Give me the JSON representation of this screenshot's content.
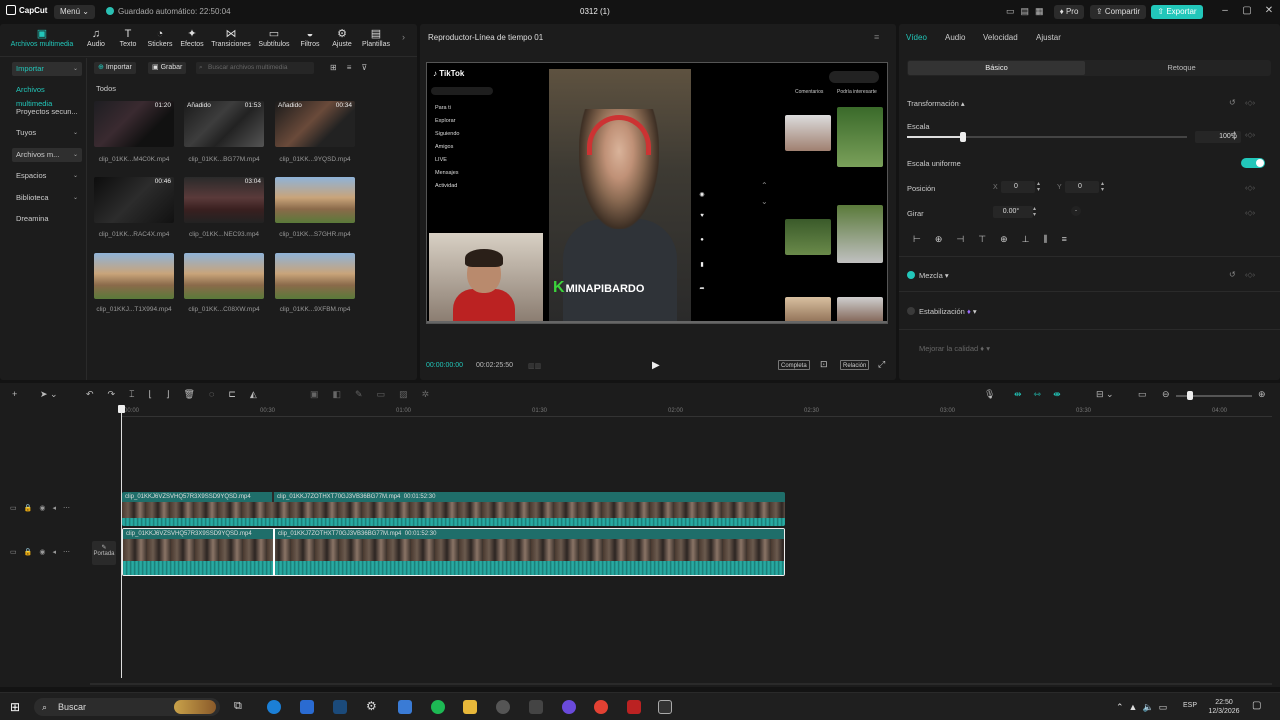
{
  "titlebar": {
    "app_name": "CapCut",
    "menu_label": "Menú",
    "autosave": "Guardado automático: 22:50:04",
    "project_title": "0312 (1)",
    "pro_label": "Pro",
    "share_label": "Compartir",
    "export_label": "Exportar"
  },
  "toolbar": {
    "items": [
      {
        "label": "Archivos multimedia",
        "icon": "media-icon"
      },
      {
        "label": "Audio",
        "icon": "audio-icon"
      },
      {
        "label": "Texto",
        "icon": "text-icon"
      },
      {
        "label": "Stickers",
        "icon": "sticker-icon"
      },
      {
        "label": "Efectos",
        "icon": "effects-icon"
      },
      {
        "label": "Transiciones",
        "icon": "transitions-icon"
      },
      {
        "label": "Subtítulos",
        "icon": "subtitles-icon"
      },
      {
        "label": "Filtros",
        "icon": "filters-icon"
      },
      {
        "label": "Ajuste",
        "icon": "adjust-icon"
      },
      {
        "label": "Plantillas",
        "icon": "templates-icon"
      }
    ]
  },
  "sidebar": {
    "items": [
      {
        "label": "Importar"
      },
      {
        "label": "Archivos multimedia"
      },
      {
        "label": "Proyectos secun..."
      },
      {
        "label": "Tuyos"
      },
      {
        "label": "Archivos m..."
      },
      {
        "label": "Espacios"
      },
      {
        "label": "Biblioteca"
      },
      {
        "label": "Dreamina"
      }
    ]
  },
  "media": {
    "import_label": "Importar",
    "record_label": "Grabar",
    "search_placeholder": "Buscar archivos multimedia",
    "filter_label": "Todos",
    "clips": [
      {
        "name": "clip_01KK...M4C0K.mp4",
        "duration": "01:20",
        "added": ""
      },
      {
        "name": "clip_01KK...BG77M.mp4",
        "duration": "01:53",
        "added": "Añadido"
      },
      {
        "name": "clip_01KK...9YQSD.mp4",
        "duration": "00:34",
        "added": "Añadido"
      },
      {
        "name": "clip_01KK...RAC4X.mp4",
        "duration": "00:46",
        "added": ""
      },
      {
        "name": "clip_01KK...NEC93.mp4",
        "duration": "03:04",
        "added": ""
      },
      {
        "name": "clip_01KK...S7GHR.mp4",
        "duration": "",
        "added": ""
      },
      {
        "name": "clip_01KKJ...T1X994.mp4",
        "duration": "",
        "added": ""
      },
      {
        "name": "clip_01KK...C08XW.mp4",
        "duration": "",
        "added": ""
      },
      {
        "name": "clip_01KK...9XFBM.mp4",
        "duration": "",
        "added": ""
      }
    ]
  },
  "player": {
    "title": "Reproductor-Línea de tiempo 01",
    "current_time": "00:00:00:00",
    "total_time": "00:02:25:50",
    "btn_complete": "Completa",
    "btn_ratio": "Relación",
    "tiktok": {
      "logo": "TikTok",
      "nav": [
        "Para ti",
        "Explorar",
        "Siguiendo",
        "Amigos",
        "LIVE",
        "Mensajes",
        "Actividad"
      ],
      "banner": "MINAPIBARDO",
      "banner_k": "K",
      "right_tabs": [
        "Comentarios",
        "Podría interesarte"
      ]
    }
  },
  "props": {
    "tabs": [
      "Vídeo",
      "Audio",
      "Velocidad",
      "Ajustar"
    ],
    "seg_basic": "Básico",
    "seg_retouch": "Retoque",
    "transform": "Transformación",
    "scale_label": "Escala",
    "scale_value": "100%",
    "scale_fraction": 0.2,
    "uniform_label": "Escala uniforme",
    "position_label": "Posición",
    "pos_x_label": "X",
    "pos_x": "0",
    "pos_y_label": "Y",
    "pos_y": "0",
    "rotate_label": "Girar",
    "rotate_value": "0.00°",
    "blend_label": "Mezcla",
    "stabilize_label": "Estabilización",
    "quality_label": "Mejorar la calidad"
  },
  "timeline": {
    "ruler": [
      "00:00",
      "00:30",
      "01:00",
      "01:30",
      "02:00",
      "02:30",
      "03:00",
      "03:30",
      "04:00"
    ],
    "track1": {
      "clip_a": "clip_01KKJ6VZSVHQ57R3X9SSD9YQSD.mp4",
      "clip_b": "clip_01KKJ7ZOTHXT70GJ3VB36BG77M.mp4",
      "clip_b_dur": "00:01:52:30"
    },
    "track2": {
      "clip_a": "clip_01KKJ6VZSVHQ57R3X9SSD9YQSD.mp4",
      "clip_b": "clip_01KKJ7ZOTHXT70GJ3VB36BG77M.mp4",
      "clip_b_dur": "00:01:52:30"
    },
    "cover_label": "Portada"
  },
  "taskbar": {
    "search_label": "Buscar",
    "lang": "ESP",
    "time": "22:50",
    "date": "12/3/2026"
  },
  "colors": {
    "accent": "#22c7ba",
    "panel": "#1c1c1c",
    "background": "#131313"
  }
}
